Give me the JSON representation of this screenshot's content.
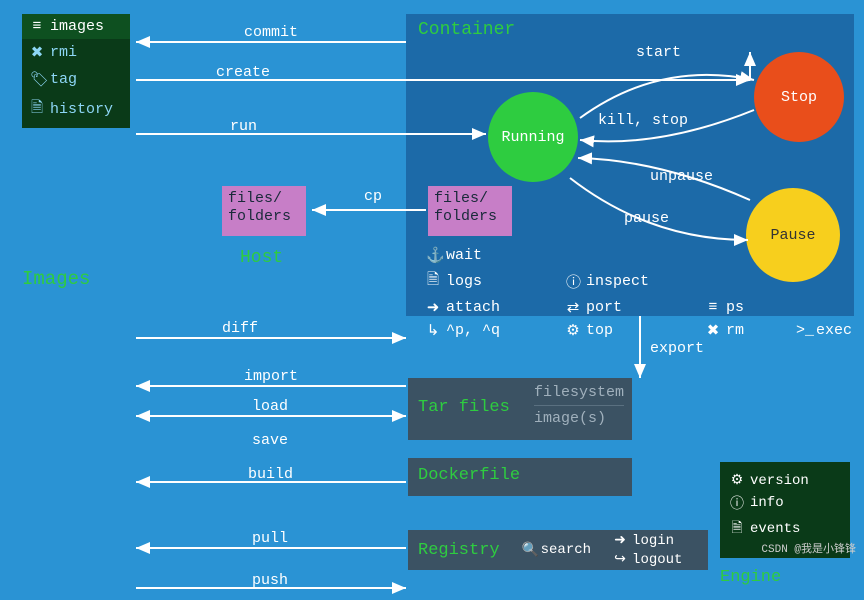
{
  "sidebar": {
    "items": [
      {
        "icon": "≡",
        "label": "images"
      },
      {
        "icon": "✖",
        "label": "rmi"
      },
      {
        "icon": "🏷",
        "label": "tag"
      },
      {
        "icon": "🗎",
        "label": "history"
      }
    ]
  },
  "labels": {
    "images": "Images",
    "host": "Host",
    "container": "Container",
    "engine": "Engine",
    "tarfiles": "Tar files",
    "dockerfile": "Dockerfile",
    "registry": "Registry",
    "filesfolders": "files/\nfolders"
  },
  "states": {
    "running": "Running",
    "stop": "Stop",
    "pause": "Pause"
  },
  "cmds": {
    "wait": "wait",
    "logs": "logs",
    "attach": "attach",
    "pq": "^p, ^q",
    "inspect": "inspect",
    "port": "port",
    "top": "top",
    "ps": "ps",
    "rm": "rm",
    "exec": "exec"
  },
  "icons": {
    "wait": "⚓",
    "logs": "🗎",
    "attach": "➜",
    "pq": "↳",
    "inspect": "ⓘ",
    "port": "⇄",
    "top": "⚙",
    "ps": "≡",
    "rm": "✖",
    "exec": ">_"
  },
  "tar": {
    "fs": "filesystem",
    "img": "image(s)"
  },
  "registry": {
    "search": "search",
    "login": "login",
    "logout": "logout"
  },
  "registry_icons": {
    "search": "🔍",
    "login": "➜",
    "logout": "↪"
  },
  "engine": {
    "items": [
      {
        "icon": "⚙",
        "label": "version"
      },
      {
        "icon": "ⓘ",
        "label": "info"
      },
      {
        "icon": "🗎",
        "label": "events"
      }
    ]
  },
  "arrows": {
    "commit": "commit",
    "create": "create",
    "run": "run",
    "cp": "cp",
    "start": "start",
    "killstop": "kill, stop",
    "unpause": "unpause",
    "pause": "pause",
    "diff": "diff",
    "import": "import",
    "load": "load",
    "save": "save",
    "export": "export",
    "build": "build",
    "pull": "pull",
    "push": "push"
  },
  "watermark": "CSDN @我是小锋锋"
}
